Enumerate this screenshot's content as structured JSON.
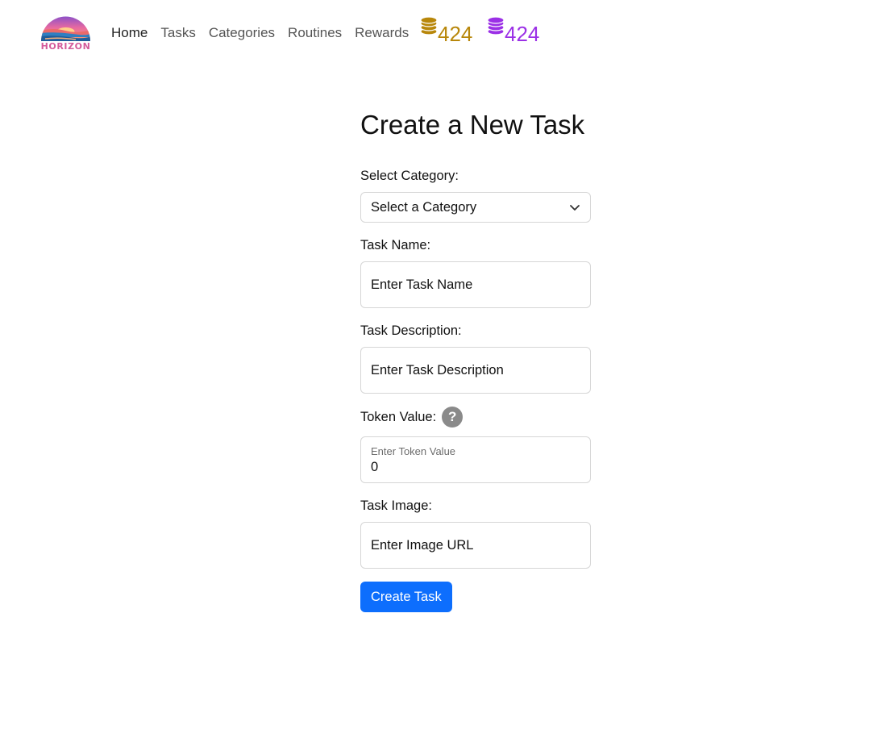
{
  "brand": {
    "wordmark": "HORIZON"
  },
  "nav": {
    "items": [
      {
        "label": "Home",
        "active": true
      },
      {
        "label": "Tasks"
      },
      {
        "label": "Categories"
      },
      {
        "label": "Routines"
      },
      {
        "label": "Rewards"
      }
    ]
  },
  "tokens": {
    "gold": {
      "amount": "424",
      "color": "#b8870b",
      "icon": "coins-stack-icon"
    },
    "purple": {
      "amount": "424",
      "color": "#9b30e6",
      "icon": "coins-stack-icon"
    }
  },
  "form": {
    "title": "Create a New Task",
    "category": {
      "label": "Select Category:",
      "selected": "Select a Category"
    },
    "task_name": {
      "label": "Task Name:",
      "placeholder": "Enter Task Name"
    },
    "task_description": {
      "label": "Task Description:",
      "placeholder": "Enter Task Description"
    },
    "token_value": {
      "label": "Token Value:",
      "floating_label": "Enter Token Value",
      "value": "0",
      "help_glyph": "?"
    },
    "task_image": {
      "label": "Task Image:",
      "placeholder": "Enter Image URL"
    },
    "submit_label": "Create Task"
  },
  "colors": {
    "primary": "#0d6efd",
    "help_badge": "#8a8a8a"
  }
}
